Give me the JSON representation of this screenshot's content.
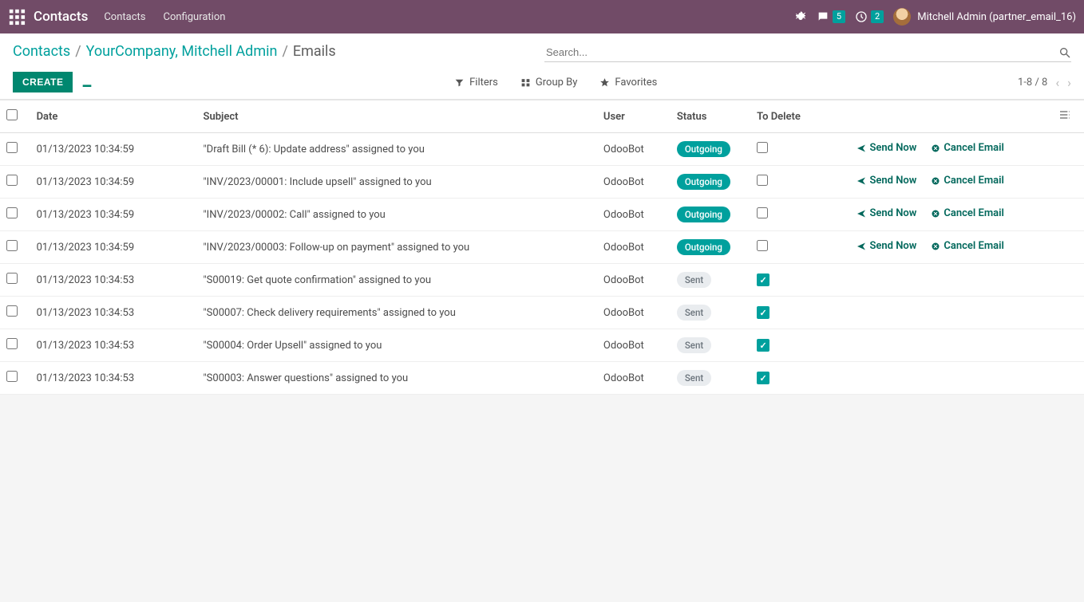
{
  "navbar": {
    "brand": "Contacts",
    "links": [
      "Contacts",
      "Configuration"
    ],
    "msg_count": "5",
    "activity_count": "2",
    "user_label": "Mitchell Admin (partner_email_16)"
  },
  "breadcrumb": {
    "items": [
      "Contacts",
      "YourCompany, Mitchell Admin"
    ],
    "current": "Emails"
  },
  "search": {
    "placeholder": "Search..."
  },
  "buttons": {
    "create": "CREATE"
  },
  "tools": {
    "filters": "Filters",
    "group_by": "Group By",
    "favorites": "Favorites"
  },
  "pager": {
    "text": "1-8 / 8"
  },
  "columns": {
    "date": "Date",
    "subject": "Subject",
    "user": "User",
    "status": "Status",
    "to_delete": "To Delete"
  },
  "status_labels": {
    "outgoing": "Outgoing",
    "sent": "Sent"
  },
  "action_labels": {
    "send_now": "Send Now",
    "cancel_email": "Cancel Email"
  },
  "rows": [
    {
      "date": "01/13/2023 10:34:59",
      "subject": "\"Draft Bill (* 6): Update address\" assigned to you",
      "user": "OdooBot",
      "status": "outgoing",
      "to_delete": false,
      "show_actions": true
    },
    {
      "date": "01/13/2023 10:34:59",
      "subject": "\"INV/2023/00001: Include upsell\" assigned to you",
      "user": "OdooBot",
      "status": "outgoing",
      "to_delete": false,
      "show_actions": true
    },
    {
      "date": "01/13/2023 10:34:59",
      "subject": "\"INV/2023/00002: Call\" assigned to you",
      "user": "OdooBot",
      "status": "outgoing",
      "to_delete": false,
      "show_actions": true
    },
    {
      "date": "01/13/2023 10:34:59",
      "subject": "\"INV/2023/00003: Follow-up on payment\" assigned to you",
      "user": "OdooBot",
      "status": "outgoing",
      "to_delete": false,
      "show_actions": true
    },
    {
      "date": "01/13/2023 10:34:53",
      "subject": "\"S00019: Get quote confirmation\" assigned to you",
      "user": "OdooBot",
      "status": "sent",
      "to_delete": true,
      "show_actions": false
    },
    {
      "date": "01/13/2023 10:34:53",
      "subject": "\"S00007: Check delivery requirements\" assigned to you",
      "user": "OdooBot",
      "status": "sent",
      "to_delete": true,
      "show_actions": false
    },
    {
      "date": "01/13/2023 10:34:53",
      "subject": "\"S00004: Order Upsell\" assigned to you",
      "user": "OdooBot",
      "status": "sent",
      "to_delete": true,
      "show_actions": false
    },
    {
      "date": "01/13/2023 10:34:53",
      "subject": "\"S00003: Answer questions\" assigned to you",
      "user": "OdooBot",
      "status": "sent",
      "to_delete": true,
      "show_actions": false
    }
  ]
}
